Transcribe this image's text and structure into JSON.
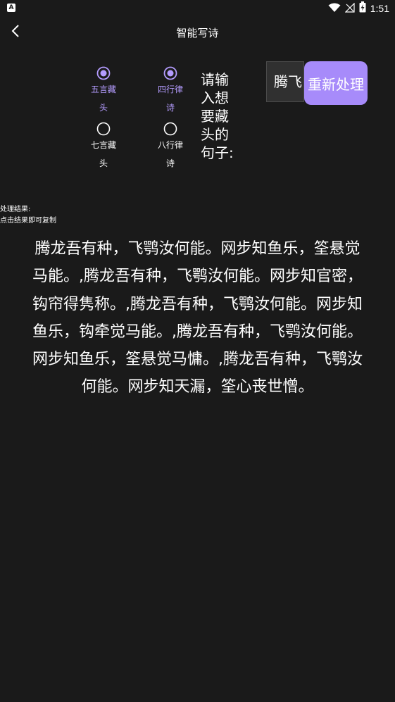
{
  "status_bar": {
    "app_icon_letter": "A",
    "time": "1:51",
    "icons": [
      "wifi-icon",
      "no-signal-icon",
      "battery-charging-icon"
    ]
  },
  "app_bar": {
    "back_icon": "chevron-left-icon",
    "title": "智能写诗"
  },
  "options": {
    "group1": [
      {
        "label": "五言藏头",
        "checked": true
      },
      {
        "label": "七言藏头",
        "checked": false
      }
    ],
    "group2": [
      {
        "label": "四行律诗",
        "checked": true
      },
      {
        "label": "八行律诗",
        "checked": false
      }
    ]
  },
  "input": {
    "prompt": "请输入想要藏头的句子:",
    "value": "腾飞"
  },
  "reprocess_button": {
    "label": "重新处理"
  },
  "result": {
    "heading_line1": "处理结果:",
    "heading_line2": "点击结果即可复制",
    "text": "腾龙吾有种，飞鹗汝何能。网步知鱼乐，筌悬觉马能。,腾龙吾有种，飞鹗汝何能。网步知官密，钩帘得隽称。,腾龙吾有种，飞鹗汝何能。网步知鱼乐，钩牵觉马能。,腾龙吾有种，飞鹗汝何能。网步知鱼乐，筌悬觉马慵。,腾龙吾有种，飞鹗汝何能。网步知天漏，筌心丧世憎。"
  },
  "colors": {
    "background": "#1a1a1a",
    "accent": "#a78bfa",
    "checked_label": "#b49cff",
    "text": "#ffffff"
  }
}
